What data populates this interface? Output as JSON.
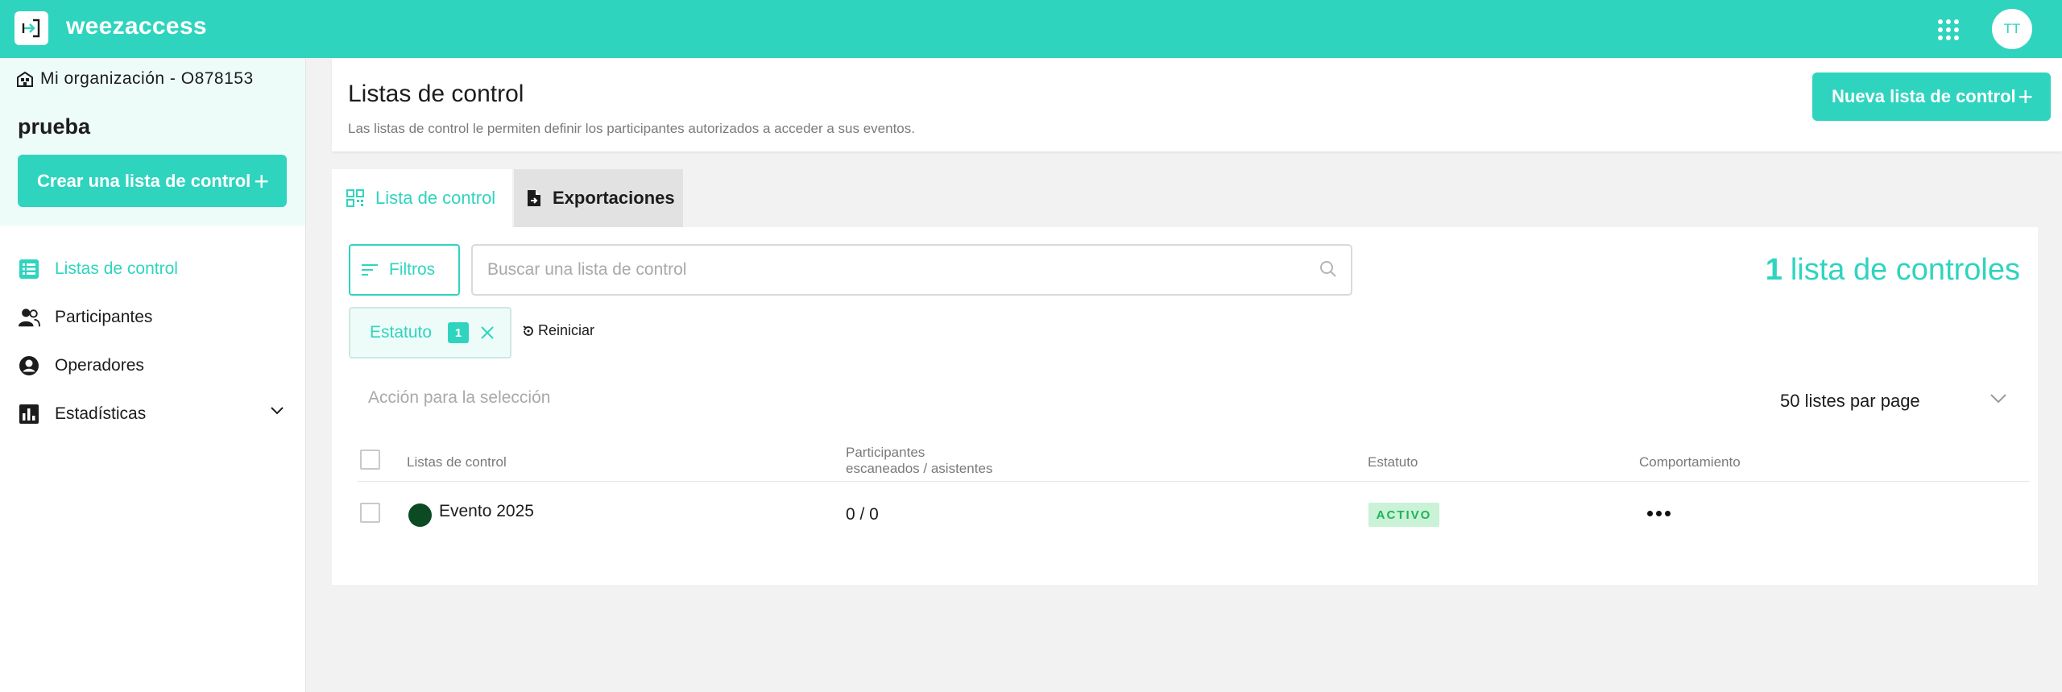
{
  "app": {
    "brand": "weezaccess",
    "avatar_initials": "TT",
    "accent_color": "#2fd4bf"
  },
  "sidebar": {
    "org_label": "Mi organización - O878153",
    "event_name": "prueba",
    "create_button": "Crear una lista de control",
    "items": [
      {
        "label": "Listas de control",
        "icon": "list-icon",
        "active": true
      },
      {
        "label": "Participantes",
        "icon": "people-icon",
        "active": false
      },
      {
        "label": "Operadores",
        "icon": "user-circle-icon",
        "active": false
      },
      {
        "label": "Estadísticas",
        "icon": "bar-chart-icon",
        "active": false,
        "expandable": true
      }
    ]
  },
  "header": {
    "title": "Listas de control",
    "description": "Las listas de control le permiten definir los participantes autorizados a acceder a sus eventos.",
    "new_button": "Nueva lista de control"
  },
  "tabs": [
    {
      "label": "Lista de control",
      "icon": "qr-code-icon",
      "active": true
    },
    {
      "label": "Exportaciones",
      "icon": "file-export-icon",
      "active": false
    }
  ],
  "toolbar": {
    "filters_label": "Filtros",
    "search_placeholder": "Buscar una lista de control",
    "count_number": "1",
    "count_label": "lista de controles"
  },
  "active_filter": {
    "label": "Estatuto",
    "count": "1",
    "reset_label": "Reiniciar"
  },
  "bulk_action_placeholder": "Acción para la selección",
  "per_page": "50 listes par page",
  "table": {
    "columns": {
      "name": "Listas de control",
      "participants_line1": "Participantes",
      "participants_line2": "escaneados / asistentes",
      "status": "Estatuto",
      "behavior": "Comportamiento"
    },
    "rows": [
      {
        "name": "Evento 2025",
        "color": "#0b4a22",
        "participants": "0 / 0",
        "status": "ACTIVO",
        "status_color": "#22b356"
      }
    ]
  }
}
